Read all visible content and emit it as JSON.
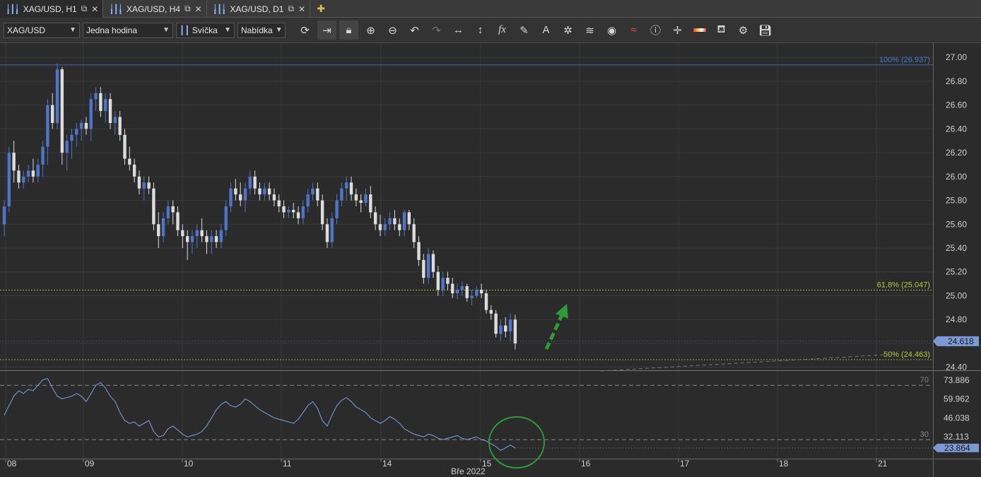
{
  "tabs": [
    {
      "label": "XAG/USD, H1",
      "active": true
    },
    {
      "label": "XAG/USD, H4",
      "active": false
    },
    {
      "label": "XAG/USD, D1",
      "active": false
    }
  ],
  "toolbar": {
    "symbol": "XAG/USD",
    "period": "Jedna hodina",
    "chart_type": "Svíčka",
    "price_side": "Nabídka",
    "icons": [
      "refresh-icon",
      "autoscroll-icon",
      "lock-icon",
      "zoom-in-icon",
      "zoom-out-icon",
      "undo-icon",
      "redo-icon",
      "horizontal-line-icon",
      "vertical-line-icon",
      "fx-indicator-icon",
      "pencil-draw-icon",
      "text-tool-icon",
      "cursor-crosshair-icon",
      "layers-icon",
      "eye-icon",
      "signals-icon",
      "info-icon",
      "crosshair-icon",
      "colors-icon",
      "paint-bucket-icon",
      "settings-ring-icon",
      "save-icon"
    ]
  },
  "colors": {
    "bull": "#4f74c8",
    "bear": "#dcdcdc",
    "fib100": "#4a78d4",
    "fib618": "#b7c93a",
    "rsi": "#7a95d6",
    "arrow": "#2e9a3a",
    "circle": "#2e9a3a"
  },
  "price_axis": {
    "ticks": [
      "27.00",
      "26.80",
      "26.60",
      "26.40",
      "26.20",
      "26.00",
      "25.80",
      "25.60",
      "25.40",
      "25.20",
      "25.00",
      "24.80",
      "24.60",
      "24.40"
    ],
    "ylim": [
      24.38,
      27.12
    ],
    "current_price": "24.618"
  },
  "fib_levels": [
    {
      "label": "100% (26.937)",
      "value": 26.937,
      "color": "#4a78d4"
    },
    {
      "label": "61.8% (25.047)",
      "value": 25.047,
      "color": "#b7c93a"
    },
    {
      "label": "50% (24.463)",
      "value": 24.463,
      "color": "#b7c93a"
    }
  ],
  "rsi_axis": {
    "ticks": [
      "73.886",
      "59.962",
      "46.038",
      "32.113"
    ],
    "ylim": [
      16,
      80
    ],
    "level_labels": [
      "70",
      "30"
    ],
    "current_value": "23.864"
  },
  "time_axis": {
    "labels": [
      "08",
      "09",
      "10",
      "11",
      "14",
      "15",
      "16",
      "17",
      "18",
      "21"
    ],
    "month_label": "Bře 2022"
  },
  "chart_data": {
    "type": "candlestick",
    "candles": [
      [
        25.6,
        25.8,
        25.5,
        25.75
      ],
      [
        25.75,
        26.25,
        25.7,
        26.2
      ],
      [
        26.2,
        26.3,
        25.95,
        26.05
      ],
      [
        26.05,
        26.1,
        25.9,
        25.95
      ],
      [
        25.95,
        26.05,
        25.9,
        26.0
      ],
      [
        26.0,
        26.1,
        25.95,
        26.05
      ],
      [
        26.05,
        26.15,
        25.95,
        26.0
      ],
      [
        26.0,
        26.15,
        25.95,
        26.1
      ],
      [
        26.1,
        26.3,
        26.0,
        26.25
      ],
      [
        26.25,
        26.65,
        26.1,
        26.6
      ],
      [
        26.6,
        26.7,
        26.4,
        26.45
      ],
      [
        26.45,
        26.95,
        26.4,
        26.9
      ],
      [
        26.9,
        26.92,
        26.1,
        26.2
      ],
      [
        26.2,
        26.35,
        26.05,
        26.3
      ],
      [
        26.3,
        26.4,
        26.15,
        26.35
      ],
      [
        26.35,
        26.45,
        26.25,
        26.4
      ],
      [
        26.4,
        26.48,
        26.3,
        26.45
      ],
      [
        26.45,
        26.5,
        26.35,
        26.4
      ],
      [
        26.4,
        26.7,
        26.3,
        26.65
      ],
      [
        26.65,
        26.75,
        26.55,
        26.7
      ],
      [
        26.7,
        26.75,
        26.5,
        26.55
      ],
      [
        26.55,
        26.7,
        26.45,
        26.65
      ],
      [
        26.65,
        26.7,
        26.4,
        26.45
      ],
      [
        26.45,
        26.55,
        26.35,
        26.5
      ],
      [
        26.5,
        26.55,
        26.3,
        26.35
      ],
      [
        26.35,
        26.4,
        26.1,
        26.15
      ],
      [
        26.15,
        26.25,
        26.05,
        26.1
      ],
      [
        26.1,
        26.15,
        25.95,
        26.0
      ],
      [
        26.0,
        26.05,
        25.85,
        25.9
      ],
      [
        25.9,
        26.0,
        25.8,
        25.95
      ],
      [
        25.95,
        26.0,
        25.85,
        25.9
      ],
      [
        25.9,
        25.95,
        25.55,
        25.6
      ],
      [
        25.6,
        25.7,
        25.4,
        25.5
      ],
      [
        25.5,
        25.7,
        25.45,
        25.65
      ],
      [
        25.65,
        25.8,
        25.6,
        25.75
      ],
      [
        25.75,
        25.8,
        25.6,
        25.7
      ],
      [
        25.7,
        25.75,
        25.5,
        25.55
      ],
      [
        25.55,
        25.6,
        25.4,
        25.5
      ],
      [
        25.5,
        25.55,
        25.3,
        25.45
      ],
      [
        25.45,
        25.55,
        25.35,
        25.5
      ],
      [
        25.5,
        25.6,
        25.4,
        25.55
      ],
      [
        25.55,
        25.65,
        25.45,
        25.5
      ],
      [
        25.5,
        25.55,
        25.35,
        25.45
      ],
      [
        25.45,
        25.55,
        25.35,
        25.5
      ],
      [
        25.5,
        25.55,
        25.4,
        25.45
      ],
      [
        25.45,
        25.6,
        25.4,
        25.55
      ],
      [
        25.55,
        25.8,
        25.5,
        25.75
      ],
      [
        25.75,
        25.95,
        25.7,
        25.9
      ],
      [
        25.9,
        25.98,
        25.8,
        25.85
      ],
      [
        25.85,
        25.95,
        25.75,
        25.8
      ],
      [
        25.8,
        25.95,
        25.7,
        25.9
      ],
      [
        25.9,
        26.05,
        25.85,
        26.0
      ],
      [
        26.0,
        26.05,
        25.85,
        25.9
      ],
      [
        25.9,
        25.95,
        25.8,
        25.85
      ],
      [
        25.85,
        25.95,
        25.8,
        25.9
      ],
      [
        25.9,
        25.95,
        25.8,
        25.85
      ],
      [
        25.85,
        25.9,
        25.75,
        25.8
      ],
      [
        25.8,
        25.85,
        25.7,
        25.75
      ],
      [
        25.75,
        25.8,
        25.65,
        25.7
      ],
      [
        25.7,
        25.75,
        25.65,
        25.72
      ],
      [
        25.72,
        25.78,
        25.65,
        25.7
      ],
      [
        25.7,
        25.75,
        25.6,
        25.65
      ],
      [
        25.65,
        25.8,
        25.6,
        25.75
      ],
      [
        25.75,
        25.9,
        25.7,
        25.85
      ],
      [
        25.85,
        25.95,
        25.8,
        25.9
      ],
      [
        25.9,
        25.95,
        25.75,
        25.8
      ],
      [
        25.8,
        25.85,
        25.55,
        25.6
      ],
      [
        25.6,
        25.65,
        25.4,
        25.45
      ],
      [
        25.45,
        25.7,
        25.4,
        25.65
      ],
      [
        25.65,
        25.85,
        25.6,
        25.8
      ],
      [
        25.8,
        25.95,
        25.75,
        25.9
      ],
      [
        25.9,
        26.0,
        25.8,
        25.95
      ],
      [
        25.95,
        26.0,
        25.8,
        25.85
      ],
      [
        25.85,
        25.9,
        25.75,
        25.8
      ],
      [
        25.8,
        25.85,
        25.7,
        25.78
      ],
      [
        25.78,
        25.9,
        25.75,
        25.85
      ],
      [
        25.85,
        25.92,
        25.65,
        25.7
      ],
      [
        25.7,
        25.75,
        25.55,
        25.6
      ],
      [
        25.6,
        25.68,
        25.5,
        25.55
      ],
      [
        25.55,
        25.65,
        25.5,
        25.6
      ],
      [
        25.6,
        25.7,
        25.55,
        25.65
      ],
      [
        25.65,
        25.72,
        25.55,
        25.6
      ],
      [
        25.6,
        25.65,
        25.5,
        25.55
      ],
      [
        25.55,
        25.72,
        25.5,
        25.7
      ],
      [
        25.7,
        25.72,
        25.55,
        25.6
      ],
      [
        25.6,
        25.65,
        25.4,
        25.45
      ],
      [
        25.45,
        25.5,
        25.25,
        25.3
      ],
      [
        25.3,
        25.35,
        25.1,
        25.15
      ],
      [
        25.15,
        25.4,
        25.1,
        25.35
      ],
      [
        25.35,
        25.38,
        25.15,
        25.2
      ],
      [
        25.2,
        25.25,
        25.0,
        25.05
      ],
      [
        25.05,
        25.2,
        25.0,
        25.15
      ],
      [
        25.15,
        25.2,
        25.05,
        25.1
      ],
      [
        25.1,
        25.15,
        24.98,
        25.02
      ],
      [
        25.02,
        25.1,
        24.97,
        25.05
      ],
      [
        25.05,
        25.12,
        25.0,
        25.08
      ],
      [
        25.08,
        25.1,
        24.95,
        24.98
      ],
      [
        24.98,
        25.05,
        24.92,
        25.0
      ],
      [
        25.0,
        25.08,
        24.98,
        25.05
      ],
      [
        25.05,
        25.1,
        24.98,
        25.02
      ],
      [
        25.02,
        25.05,
        24.85,
        24.88
      ],
      [
        24.88,
        24.92,
        24.8,
        24.85
      ],
      [
        24.85,
        24.88,
        24.65,
        24.68
      ],
      [
        24.68,
        24.8,
        24.62,
        24.75
      ],
      [
        24.75,
        24.82,
        24.65,
        24.7
      ],
      [
        24.7,
        24.85,
        24.62,
        24.8
      ],
      [
        24.8,
        24.84,
        24.55,
        24.6
      ]
    ],
    "rsi": [
      48,
      55,
      62,
      66,
      64,
      67,
      66,
      70,
      74,
      75,
      68,
      62,
      60,
      61,
      62,
      64,
      62,
      58,
      64,
      70,
      72,
      68,
      62,
      58,
      50,
      44,
      42,
      43,
      40,
      42,
      44,
      36,
      32,
      33,
      38,
      40,
      37,
      34,
      32,
      33,
      34,
      36,
      40,
      46,
      52,
      56,
      58,
      55,
      54,
      56,
      60,
      58,
      55,
      52,
      50,
      48,
      46,
      45,
      44,
      43,
      42,
      45,
      50,
      55,
      58,
      53,
      44,
      40,
      48,
      55,
      59,
      61,
      58,
      54,
      52,
      50,
      46,
      44,
      42,
      44,
      47,
      45,
      42,
      38,
      36,
      34,
      33,
      32,
      34,
      33,
      31,
      30,
      31,
      32,
      33,
      31,
      30,
      31,
      32,
      30,
      29,
      27,
      25,
      22,
      24,
      26,
      23.864
    ],
    "ylim": [
      24.38,
      27.12
    ],
    "x_labels": [
      "08",
      "09",
      "10",
      "11",
      "14",
      "15",
      "16",
      "17",
      "18",
      "21"
    ],
    "title": "",
    "xlabel": "Bře 2022",
    "ylabel": ""
  }
}
